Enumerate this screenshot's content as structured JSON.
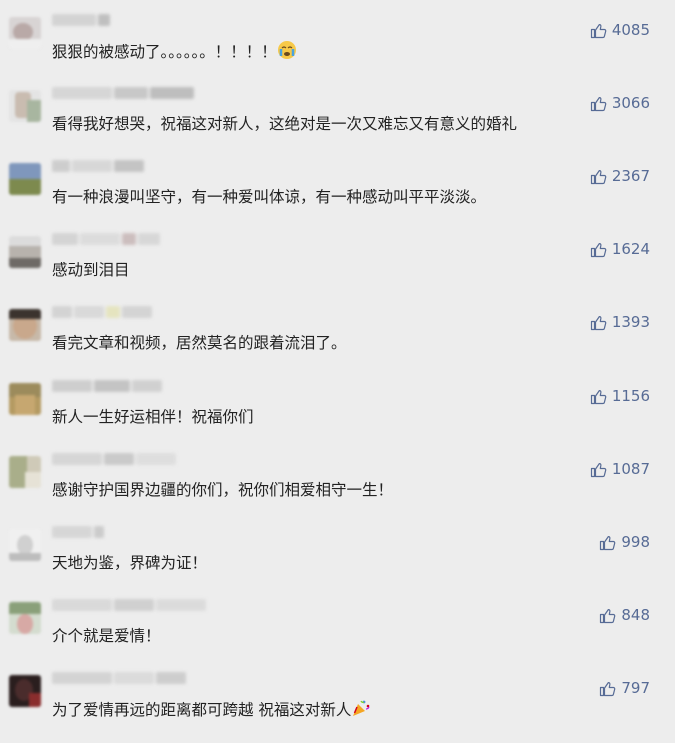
{
  "comments": [
    {
      "text": "狠狠的被感动了。。。。。。！！！！",
      "emoji": "crying-face-icon",
      "likes": "4085"
    },
    {
      "text": "看得我好想哭，祝福这对新人，这绝对是一次又难忘又有意义的婚礼",
      "likes": "3066"
    },
    {
      "text": "有一种浪漫叫坚守，有一种爱叫体谅，有一种感动叫平平淡淡。",
      "likes": "2367"
    },
    {
      "text": "感动到泪目",
      "likes": "1624"
    },
    {
      "text": "看完文章和视频，居然莫名的跟着流泪了。",
      "likes": "1393"
    },
    {
      "text": "新人一生好运相伴！祝福你们",
      "likes": "1156"
    },
    {
      "text": "感谢守护国界边疆的你们，祝你们相爱相守一生！",
      "likes": "1087"
    },
    {
      "text": "天地为鉴，界碑为证！",
      "likes": "998"
    },
    {
      "text": "介个就是爱情！",
      "likes": "848"
    },
    {
      "text": "为了爱情再远的距离都可跨越  祝福这对新人",
      "emoji": "party-popper-icon",
      "likes": "797"
    }
  ],
  "colors": {
    "background": "#ededed",
    "like_text": "#576b95",
    "comment_text": "#222222"
  }
}
